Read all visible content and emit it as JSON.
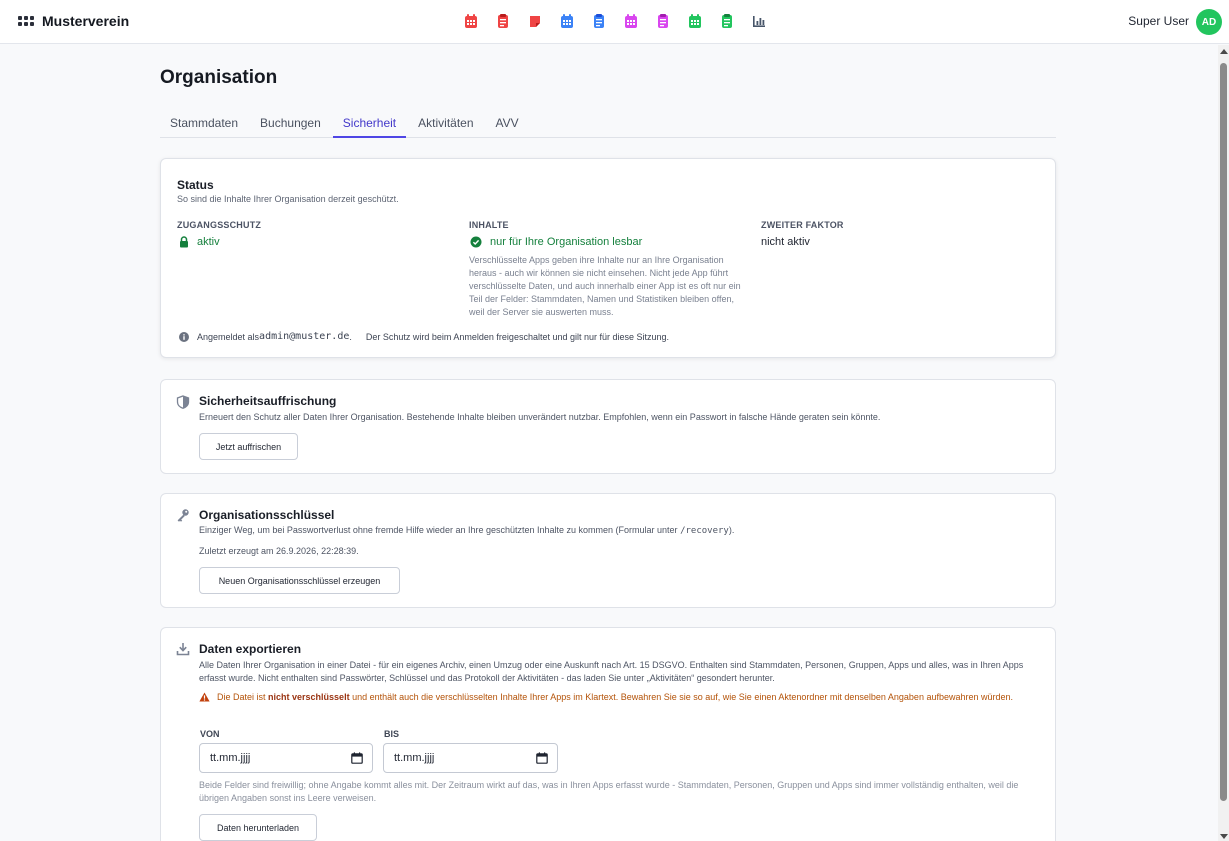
{
  "app": {
    "name": "Musterverein"
  },
  "topbar": {
    "apps": [
      {
        "icon": "calendar-icon",
        "color": "#ef4444"
      },
      {
        "icon": "clipboard-icon",
        "color": "#ef4444"
      },
      {
        "icon": "note-icon",
        "color": "#ef4444"
      },
      {
        "icon": "calendar-icon",
        "color": "#3b82f6"
      },
      {
        "icon": "clipboard-icon",
        "color": "#3b82f6"
      },
      {
        "icon": "calendar-icon",
        "color": "#d946ef"
      },
      {
        "icon": "clipboard-icon",
        "color": "#d946ef"
      },
      {
        "icon": "calendar-icon",
        "color": "#22c55e"
      },
      {
        "icon": "clipboard-icon",
        "color": "#22c55e"
      },
      {
        "icon": "bar-chart-icon",
        "color": "#475569"
      }
    ],
    "user_name": "Super User",
    "avatar_initials": "AD",
    "avatar_color": "#22c55e"
  },
  "page": {
    "title": "Organisation"
  },
  "tabs": [
    {
      "label": "Stammdaten",
      "active": false
    },
    {
      "label": "Buchungen",
      "active": false
    },
    {
      "label": "Sicherheit",
      "active": true
    },
    {
      "label": "Aktivitäten",
      "active": false
    },
    {
      "label": "AVV",
      "active": false
    }
  ],
  "status": {
    "title": "Status",
    "subtitle": "So sind die Inhalte Ihrer Organisation derzeit geschützt.",
    "access": {
      "label": "ZUGANGSSCHUTZ",
      "value": "aktiv"
    },
    "content": {
      "label": "INHALTE",
      "value": "nur für Ihre Organisation lesbar",
      "description": "Verschlüsselte Apps geben ihre Inhalte nur an Ihre Organisation heraus - auch wir können sie nicht einsehen. Nicht jede App führt verschlüsselte Daten, und auch innerhalb einer App ist es oft nur ein Teil der Felder: Stammdaten, Namen und Statistiken bleiben offen, weil der Server sie auswerten muss."
    },
    "second_factor": {
      "label": "ZWEITER FAKTOR",
      "value": "nicht aktiv"
    },
    "login_prefix": "Angemeldet als",
    "login_email": "admin@muster.de",
    "login_period": ".",
    "login_note": "Der Schutz wird beim Anmelden freigeschaltet und gilt nur für diese Sitzung."
  },
  "refresh": {
    "title": "Sicherheitsauffrischung",
    "description": "Erneuert den Schutz aller Daten Ihrer Organisation. Bestehende Inhalte bleiben unverändert nutzbar. Empfohlen, wenn ein Passwort in falsche Hände geraten sein könnte.",
    "button": "Jetzt auffrischen"
  },
  "org_key": {
    "title": "Organisationsschlüssel",
    "description_prefix": "Einziger Weg, um bei Passwortverlust ohne fremde Hilfe wieder an Ihre geschützten Inhalte zu kommen (Formular unter",
    "description_path": "/recovery",
    "description_suffix": ").",
    "last_generated": "Zuletzt erzeugt am 26.9.2026, 22:28:39.",
    "button": "Neuen Organisationsschlüssel erzeugen"
  },
  "export": {
    "title": "Daten exportieren",
    "description": "Alle Daten Ihrer Organisation in einer Datei - für ein eigenes Archiv, einen Umzug oder eine Auskunft nach Art. 15 DSGVO. Enthalten sind Stammdaten, Personen, Gruppen, Apps und alles, was in Ihren Apps erfasst wurde. Nicht enthalten sind Passwörter, Schlüssel und das Protokoll der Aktivitäten - das laden Sie unter „Aktivitäten“ gesondert herunter.",
    "warning_prefix": "Die Datei ist",
    "warning_bold": "nicht verschlüsselt",
    "warning_suffix": "und enthält auch die verschlüsselten Inhalte Ihrer Apps im Klartext. Bewahren Sie sie so auf, wie Sie einen Aktenordner mit denselben Angaben aufbewahren würden.",
    "from_label": "VON",
    "from_placeholder": "tt.mm.jjjj",
    "to_label": "BIS",
    "to_placeholder": "tt.mm.jjjj",
    "hint": "Beide Felder sind freiwillig; ohne Angabe kommt alles mit. Der Zeitraum wirkt auf das, was in Ihren Apps erfasst wurde - Stammdaten, Personen, Gruppen und Apps sind immer vollständig enthalten, weil die übrigen Angaben sonst ins Leere verweisen.",
    "button": "Daten herunterladen"
  },
  "colors": {
    "accent": "#4f46e5",
    "success": "#15803d",
    "warning": "#b45309"
  }
}
